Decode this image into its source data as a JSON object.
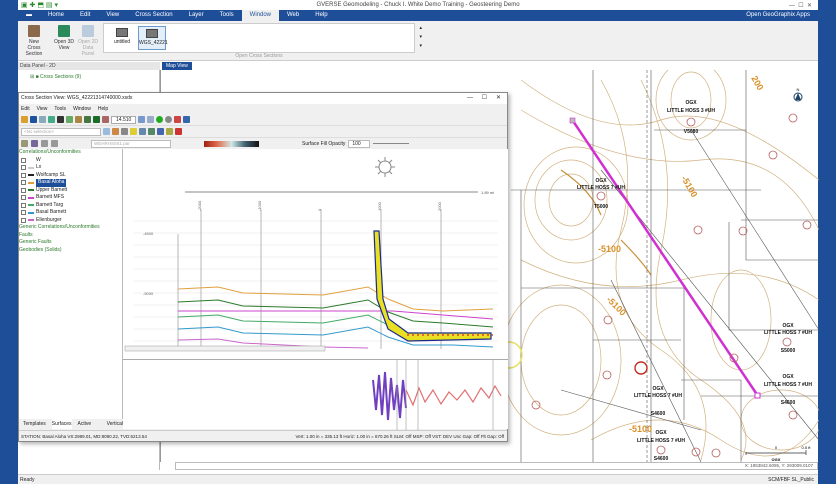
{
  "app": {
    "title": "GVERSE Geomodeling - Chuck I. White Demo Training - Geosteering Demo"
  },
  "ribbon": {
    "tabs": [
      "Home",
      "Edit",
      "View",
      "Cross Section",
      "Layer",
      "Tools",
      "Window",
      "Web",
      "Help"
    ],
    "active_tab": "Window",
    "apps_link": "Open GeoGraphix Apps",
    "buttons": {
      "new_cross_section": "New Cross Section",
      "open_3d": "Open 3D View",
      "open_2d": "Open 2D Data Panel"
    },
    "gallery": {
      "items": [
        "untitled",
        "WGS_42221"
      ],
      "group_label": "Open Cross Sections"
    }
  },
  "data_panel": {
    "header": "Data Panel - 2D",
    "item": "Cross Sections (9)"
  },
  "map": {
    "tab": "Map View",
    "coords": "X: 1953842.6095, Y: 293009.0107",
    "contours": [
      "-5100",
      "-5100",
      "-5100",
      "-5100",
      "200"
    ],
    "wells": [
      {
        "op": "OGX",
        "name": "LITTLE HOSS 3 #UH",
        "val": "V5080"
      },
      {
        "op": "OGX",
        "name": "LITTLE HOSS 7 #UH",
        "val": "T5000"
      },
      {
        "op": "OGX",
        "name": "LITTLE HOSS 7 #UH",
        "val": "S5000"
      },
      {
        "op": "OGX",
        "name": "LITTLE HOSS 7 #UH",
        "val": "S4600"
      },
      {
        "op": "OGX",
        "name": "LITTLE HOSS 7 #UH",
        "val": "S4600"
      },
      {
        "op": "OGX",
        "name": "LITTLE HOSS 7 #UH",
        "val": "S4600"
      }
    ],
    "scale": {
      "a": "0",
      "b": "0.5 ft",
      "label": "OGX"
    }
  },
  "cross_section": {
    "title": "Cross Section View: WGS_42221314740000.xsdx",
    "menu": [
      "Edit",
      "View",
      "Tools",
      "Window",
      "Help"
    ],
    "zoom": "14.510",
    "well_select": "<No selection>",
    "surface_combo": "WEHRHS0S1.par",
    "fill_opacity_label": "Surface Fill Opacity",
    "fill_opacity": "100",
    "tree": [
      {
        "label": "Correlations/Unconformities",
        "g": true
      },
      {
        "label": "W",
        "c": "#fff"
      },
      {
        "label": "Lx",
        "c": "#ccc"
      },
      {
        "label": "Wolfcamp SL",
        "c": "#222"
      },
      {
        "label": "Basal Aloha",
        "c": "#e0a040",
        "sel": true
      },
      {
        "label": "Upper Barnett",
        "c": "#2a7a2a"
      },
      {
        "label": "Barnett MFS",
        "c": "#cc44cc"
      },
      {
        "label": "Barnett Targ",
        "c": "#44aa66"
      },
      {
        "label": "Basal Barnett",
        "c": "#3399cc"
      },
      {
        "label": "Ellenburger",
        "c": "#cc66cc"
      },
      {
        "label": "Generic Correlations/Unconformities",
        "g": true
      },
      {
        "label": "Faults",
        "g": true
      },
      {
        "label": "Generic Faults",
        "g": true
      },
      {
        "label": "Geobodies (Solids)",
        "g": true
      }
    ],
    "tabs": [
      "Templates",
      "Surfaces",
      "Active Well",
      "Vertical"
    ],
    "x_ticks": [
      "-2000",
      "-1000",
      "0",
      "1000",
      "2000"
    ],
    "y_ticks": [
      "-4500",
      "-5000"
    ],
    "ruler": "1.89 mi",
    "status_left": "STATION: Basal Aloha    VS:2989.01, MD:8090.22, TVD:6213.54",
    "status_right": "Vert: 1.00 in = 335.13 ft   Horiz: 1.00 in = 670.26 ft   SLM: Off  MSP: Off   VST: DEV   Unc Gap: Off  Flt Gap: Off"
  },
  "status": "Ready",
  "status_right": "SCM/FBF   SL_Public"
}
